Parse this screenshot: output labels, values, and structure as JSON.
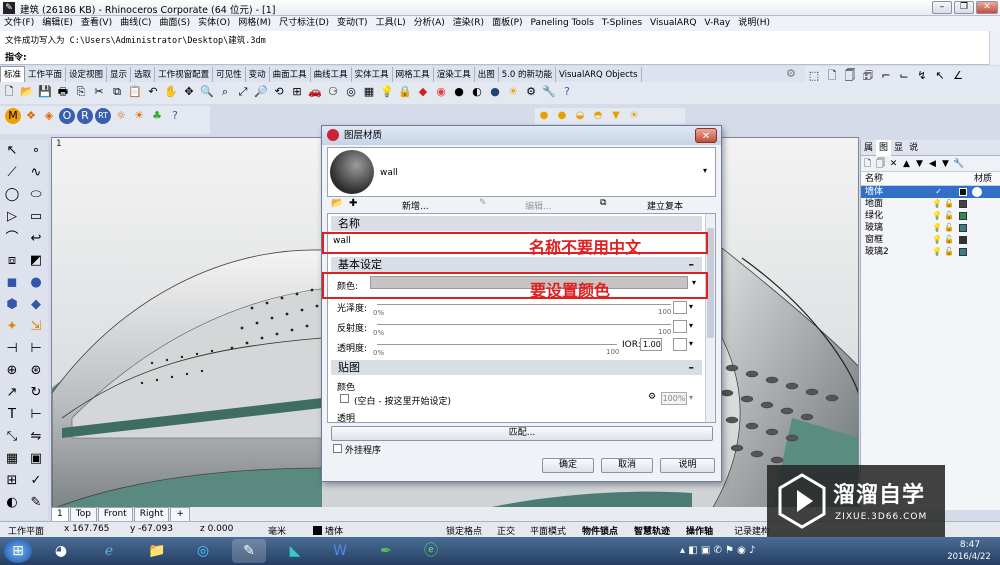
{
  "window": {
    "title": "建筑 (26186 KB) - Rhinoceros Corporate (64 位元) - [1]",
    "icon": "rhino-icon"
  },
  "menu": [
    "文件(F)",
    "编辑(E)",
    "查看(V)",
    "曲线(C)",
    "曲面(S)",
    "实体(O)",
    "网格(M)",
    "尺寸标注(D)",
    "变动(T)",
    "工具(L)",
    "分析(A)",
    "渲染(R)",
    "面板(P)",
    "Paneling Tools",
    "T-Splines",
    "VisualARQ",
    "V-Ray",
    "说明(H)"
  ],
  "command": {
    "history": "文件成功写入为 C:\\Users\\Administrator\\Desktop\\建筑.3dm",
    "prompt": "指令:"
  },
  "tabs": [
    "标准",
    "工作平面",
    "设定视图",
    "显示",
    "选取",
    "工作视窗配置",
    "可见性",
    "变动",
    "曲面工具",
    "曲线工具",
    "实体工具",
    "网格工具",
    "渲染工具",
    "出图",
    "5.0 的新功能",
    "VisualARQ Objects"
  ],
  "viewport": {
    "label": "1",
    "tabs": [
      "1",
      "Top",
      "Front",
      "Right",
      "+"
    ]
  },
  "layers": {
    "tabs": [
      "属",
      "图",
      "显",
      "说"
    ],
    "header": {
      "name": "名称",
      "material": "材质"
    },
    "rows": [
      {
        "name": "墙体",
        "color": "#111111",
        "selected": true
      },
      {
        "name": "地面",
        "color": "#444444"
      },
      {
        "name": "绿化",
        "color": "#2e8b57"
      },
      {
        "name": "玻璃",
        "color": "#3a8080"
      },
      {
        "name": "窗框",
        "color": "#333333"
      },
      {
        "name": "玻璃2",
        "color": "#3a8080"
      }
    ]
  },
  "dialog": {
    "title": "图层材质",
    "material_name": "wall",
    "toolbar": {
      "new": "新增...",
      "edit": "编辑...",
      "copy": "建立复本"
    },
    "sec_name": "名称",
    "name_value": "wall",
    "annotation_name": "名称不要用中文",
    "sec_basic": "基本设定",
    "color_label": "颜色:",
    "annotation_color": "要设置颜色",
    "gloss_label": "光泽度:",
    "reflect_label": "反射度:",
    "transp_label": "透明度:",
    "zero": "0%",
    "hundred": "100",
    "ior_label": "IOR:",
    "ior_value": "1.00",
    "sec_map": "贴图",
    "map_color": "颜色",
    "map_empty": "(空白 - 按这里开始设定)",
    "map_percent": "100%",
    "map_transp": "透明",
    "match": "匹配...",
    "plugin": "外挂程序",
    "ok": "确定",
    "cancel": "取消",
    "help": "说明"
  },
  "status": {
    "plane": "工作平面",
    "x": "x 167.765",
    "y": "y -67.093",
    "z": "z 0.000",
    "unit": "毫米",
    "layer": "墙体",
    "snap": "锁定格点",
    "ortho": "正交",
    "planar": "平面模式",
    "osnap": "物件锁点",
    "smarttrack": "智慧轨迹",
    "gumball": "操作轴",
    "history": "记录建构"
  },
  "clock": {
    "time": "8:47",
    "date": "2016/4/22"
  },
  "watermark": {
    "title": "溜溜自学",
    "sub": "ZIXUE.3D66.COM"
  }
}
